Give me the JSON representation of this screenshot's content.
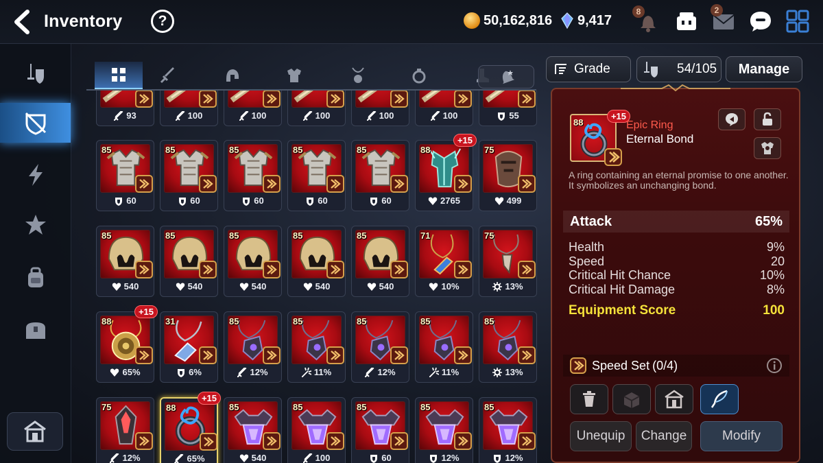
{
  "header": {
    "title": "Inventory",
    "help_label": "?",
    "gold": "50,162,816",
    "skystones": "9,417",
    "notifications_badge": "8",
    "mail_badge": "2"
  },
  "sidebar": {
    "items": [
      {
        "icon": "gear-equipment-icon",
        "active": false
      },
      {
        "icon": "shield-slash-icon",
        "active": true
      },
      {
        "icon": "lightning-icon",
        "active": false
      },
      {
        "icon": "artifact-icon",
        "active": false
      },
      {
        "icon": "backpack-icon",
        "active": false
      },
      {
        "icon": "treasure-chest-icon",
        "active": false
      }
    ],
    "bottom_icon": "storage-house-icon"
  },
  "tabs": [
    {
      "icon": "grid-all-icon",
      "active": true
    },
    {
      "icon": "sword-icon",
      "active": false
    },
    {
      "icon": "helmet-icon",
      "active": false
    },
    {
      "icon": "armor-icon",
      "active": false
    },
    {
      "icon": "necklace-icon",
      "active": false
    },
    {
      "icon": "ring-icon",
      "active": false
    },
    {
      "icon": "boots-icon",
      "active": false
    }
  ],
  "sort_icon": "bell-sort-icon",
  "controls": {
    "grade_label": "Grade",
    "capacity": "54/105",
    "manage_label": "Manage"
  },
  "grid": {
    "rows": [
      [
        {
          "type": "weapon",
          "lvl": "",
          "plus": "",
          "stat_icon": "attack",
          "stat": "93"
        },
        {
          "type": "weapon",
          "lvl": "",
          "plus": "",
          "stat_icon": "attack",
          "stat": "100"
        },
        {
          "type": "weapon",
          "lvl": "",
          "plus": "",
          "stat_icon": "attack",
          "stat": "100"
        },
        {
          "type": "weapon",
          "lvl": "",
          "plus": "",
          "stat_icon": "attack",
          "stat": "100"
        },
        {
          "type": "weapon",
          "lvl": "",
          "plus": "",
          "stat_icon": "attack",
          "stat": "100"
        },
        {
          "type": "weapon",
          "lvl": "",
          "plus": "",
          "stat_icon": "attack",
          "stat": "100"
        },
        {
          "type": "weapon",
          "lvl": "",
          "plus": "",
          "stat_icon": "defense",
          "stat": "55"
        }
      ],
      [
        {
          "type": "armor",
          "lvl": "85",
          "plus": "",
          "stat_icon": "defense",
          "stat": "60"
        },
        {
          "type": "armor",
          "lvl": "85",
          "plus": "",
          "stat_icon": "defense",
          "stat": "60"
        },
        {
          "type": "armor",
          "lvl": "85",
          "plus": "",
          "stat_icon": "defense",
          "stat": "60"
        },
        {
          "type": "armor",
          "lvl": "85",
          "plus": "",
          "stat_icon": "defense",
          "stat": "60"
        },
        {
          "type": "armor",
          "lvl": "85",
          "plus": "",
          "stat_icon": "defense",
          "stat": "60"
        },
        {
          "type": "armor-teal",
          "lvl": "88",
          "plus": "+15",
          "stat_icon": "health",
          "stat": "2765"
        },
        {
          "type": "armor-dark",
          "lvl": "75",
          "plus": "",
          "stat_icon": "health",
          "stat": "499"
        }
      ],
      [
        {
          "type": "helmet",
          "lvl": "85",
          "plus": "",
          "stat_icon": "health",
          "stat": "540"
        },
        {
          "type": "helmet",
          "lvl": "85",
          "plus": "",
          "stat_icon": "health",
          "stat": "540"
        },
        {
          "type": "helmet",
          "lvl": "85",
          "plus": "",
          "stat_icon": "health",
          "stat": "540"
        },
        {
          "type": "helmet",
          "lvl": "85",
          "plus": "",
          "stat_icon": "health",
          "stat": "540"
        },
        {
          "type": "helmet",
          "lvl": "85",
          "plus": "",
          "stat_icon": "health",
          "stat": "540"
        },
        {
          "type": "necklace-blue",
          "lvl": "71",
          "plus": "",
          "stat_icon": "health",
          "stat": "10%"
        },
        {
          "type": "necklace-claw",
          "lvl": "75",
          "plus": "",
          "stat_icon": "crit",
          "stat": "13%"
        }
      ],
      [
        {
          "type": "amulet-gold",
          "lvl": "88",
          "plus": "+15",
          "stat_icon": "health",
          "stat": "65%"
        },
        {
          "type": "necklace-silver",
          "lvl": "31",
          "plus": "",
          "stat_icon": "defense",
          "stat": "6%"
        },
        {
          "type": "necklace-dark",
          "lvl": "85",
          "plus": "",
          "stat_icon": "attack",
          "stat": "12%"
        },
        {
          "type": "necklace-dark",
          "lvl": "85",
          "plus": "",
          "stat_icon": "crit-dmg",
          "stat": "11%"
        },
        {
          "type": "necklace-dark",
          "lvl": "85",
          "plus": "",
          "stat_icon": "attack",
          "stat": "12%"
        },
        {
          "type": "necklace-dark",
          "lvl": "85",
          "plus": "",
          "stat_icon": "crit-dmg",
          "stat": "11%"
        },
        {
          "type": "necklace-dark",
          "lvl": "85",
          "plus": "",
          "stat_icon": "crit",
          "stat": "13%"
        }
      ],
      [
        {
          "type": "crystal",
          "lvl": "75",
          "plus": "",
          "stat_icon": "attack",
          "stat": "12%"
        },
        {
          "type": "ring",
          "lvl": "88",
          "plus": "+15",
          "stat_icon": "attack",
          "stat": "65%",
          "selected": true
        },
        {
          "type": "gem-purple",
          "lvl": "85",
          "plus": "",
          "stat_icon": "health",
          "stat": "540"
        },
        {
          "type": "gem-purple",
          "lvl": "85",
          "plus": "",
          "stat_icon": "attack",
          "stat": "100"
        },
        {
          "type": "gem-purple",
          "lvl": "85",
          "plus": "",
          "stat_icon": "defense",
          "stat": "60"
        },
        {
          "type": "gem-purple",
          "lvl": "85",
          "plus": "",
          "stat_icon": "defense",
          "stat": "12%"
        },
        {
          "type": "gem-purple",
          "lvl": "85",
          "plus": "",
          "stat_icon": "defense",
          "stat": "12%"
        }
      ]
    ]
  },
  "detail": {
    "level": "88",
    "plus": "+15",
    "grade": "Epic Ring",
    "name": "Eternal Bond",
    "description_1": "A ring containing an eternal promise to one another.",
    "description_2": "It symbolizes an unchanging bond.",
    "main_stat": {
      "label": "Attack",
      "value": "65%"
    },
    "sub_stats": [
      {
        "label": "Health",
        "value": "9%"
      },
      {
        "label": "Speed",
        "value": "20"
      },
      {
        "label": "Critical Hit Chance",
        "value": "10%"
      },
      {
        "label": "Critical Hit Damage",
        "value": "8%"
      }
    ],
    "score_label": "Equipment Score",
    "score_value": "100",
    "set_label": "Speed Set",
    "set_count": "(0/4)",
    "unequip_label": "Unequip",
    "change_label": "Change",
    "modify_label": "Modify"
  },
  "colors": {
    "accent_blue": "#3f8fe0",
    "epic_red": "#ff5a4c",
    "score_yellow": "#f5e23a",
    "plus_badge": "#c8141f"
  }
}
